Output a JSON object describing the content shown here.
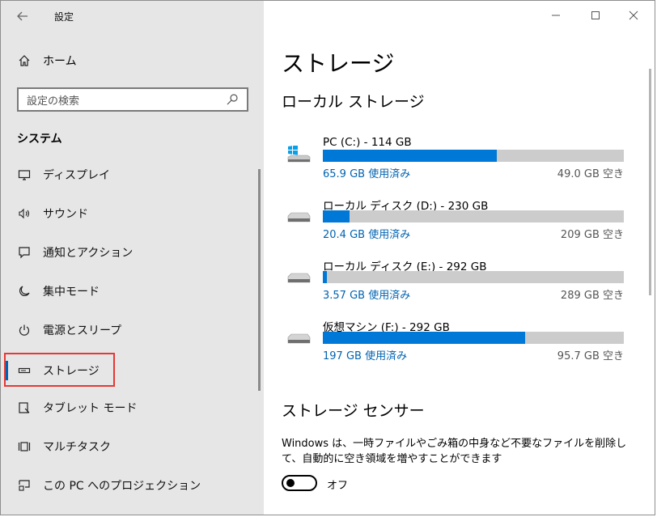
{
  "window": {
    "app_title": "設定",
    "controls": {
      "minimize": "—",
      "maximize": "☐",
      "close": "✕"
    }
  },
  "sidebar": {
    "home_label": "ホーム",
    "search_placeholder": "設定の検索",
    "section_title": "システム",
    "items": [
      {
        "label": "ディスプレイ",
        "icon": "display-icon"
      },
      {
        "label": "サウンド",
        "icon": "speaker-icon"
      },
      {
        "label": "通知とアクション",
        "icon": "notification-icon"
      },
      {
        "label": "集中モード",
        "icon": "moon-icon"
      },
      {
        "label": "電源とスリープ",
        "icon": "power-icon"
      },
      {
        "label": "ストレージ",
        "icon": "storage-icon",
        "selected": true
      },
      {
        "label": "タブレット モード",
        "icon": "tablet-icon"
      },
      {
        "label": "マルチタスク",
        "icon": "multitask-icon"
      },
      {
        "label": "この PC へのプロジェクション",
        "icon": "projection-icon"
      }
    ]
  },
  "main": {
    "title": "ストレージ",
    "local_storage_title": "ローカル ストレージ",
    "drives": [
      {
        "name": "PC (C:) - 114 GB",
        "used": "65.9 GB 使用済み",
        "free": "49.0 GB 空き",
        "used_fraction": 0.578,
        "icon": "windows-drive-icon"
      },
      {
        "name": "ローカル ディスク (D:) - 230 GB",
        "used": "20.4 GB 使用済み",
        "free": "209 GB 空き",
        "used_fraction": 0.0887,
        "icon": "hard-drive-icon"
      },
      {
        "name": "ローカル ディスク (E:) - 292 GB",
        "used": "3.57 GB 使用済み",
        "free": "289 GB 空き",
        "used_fraction": 0.0122,
        "icon": "hard-drive-icon"
      },
      {
        "name": "仮想マシン (F:) - 292 GB",
        "used": "197 GB 使用済み",
        "free": "95.7 GB 空き",
        "used_fraction": 0.673,
        "icon": "hard-drive-icon"
      }
    ],
    "sense_title": "ストレージ センサー",
    "sense_desc": "Windows は、一時ファイルやごみ箱の中身など不要なファイルを削除して、自動的に空き領域を増やすことができます",
    "toggle_label": "オフ",
    "toggle_on": false
  },
  "colors": {
    "accent": "#0078d7",
    "link": "#0063b1",
    "sidebar_bg": "#e6e6e6",
    "highlight": "#e53935"
  }
}
